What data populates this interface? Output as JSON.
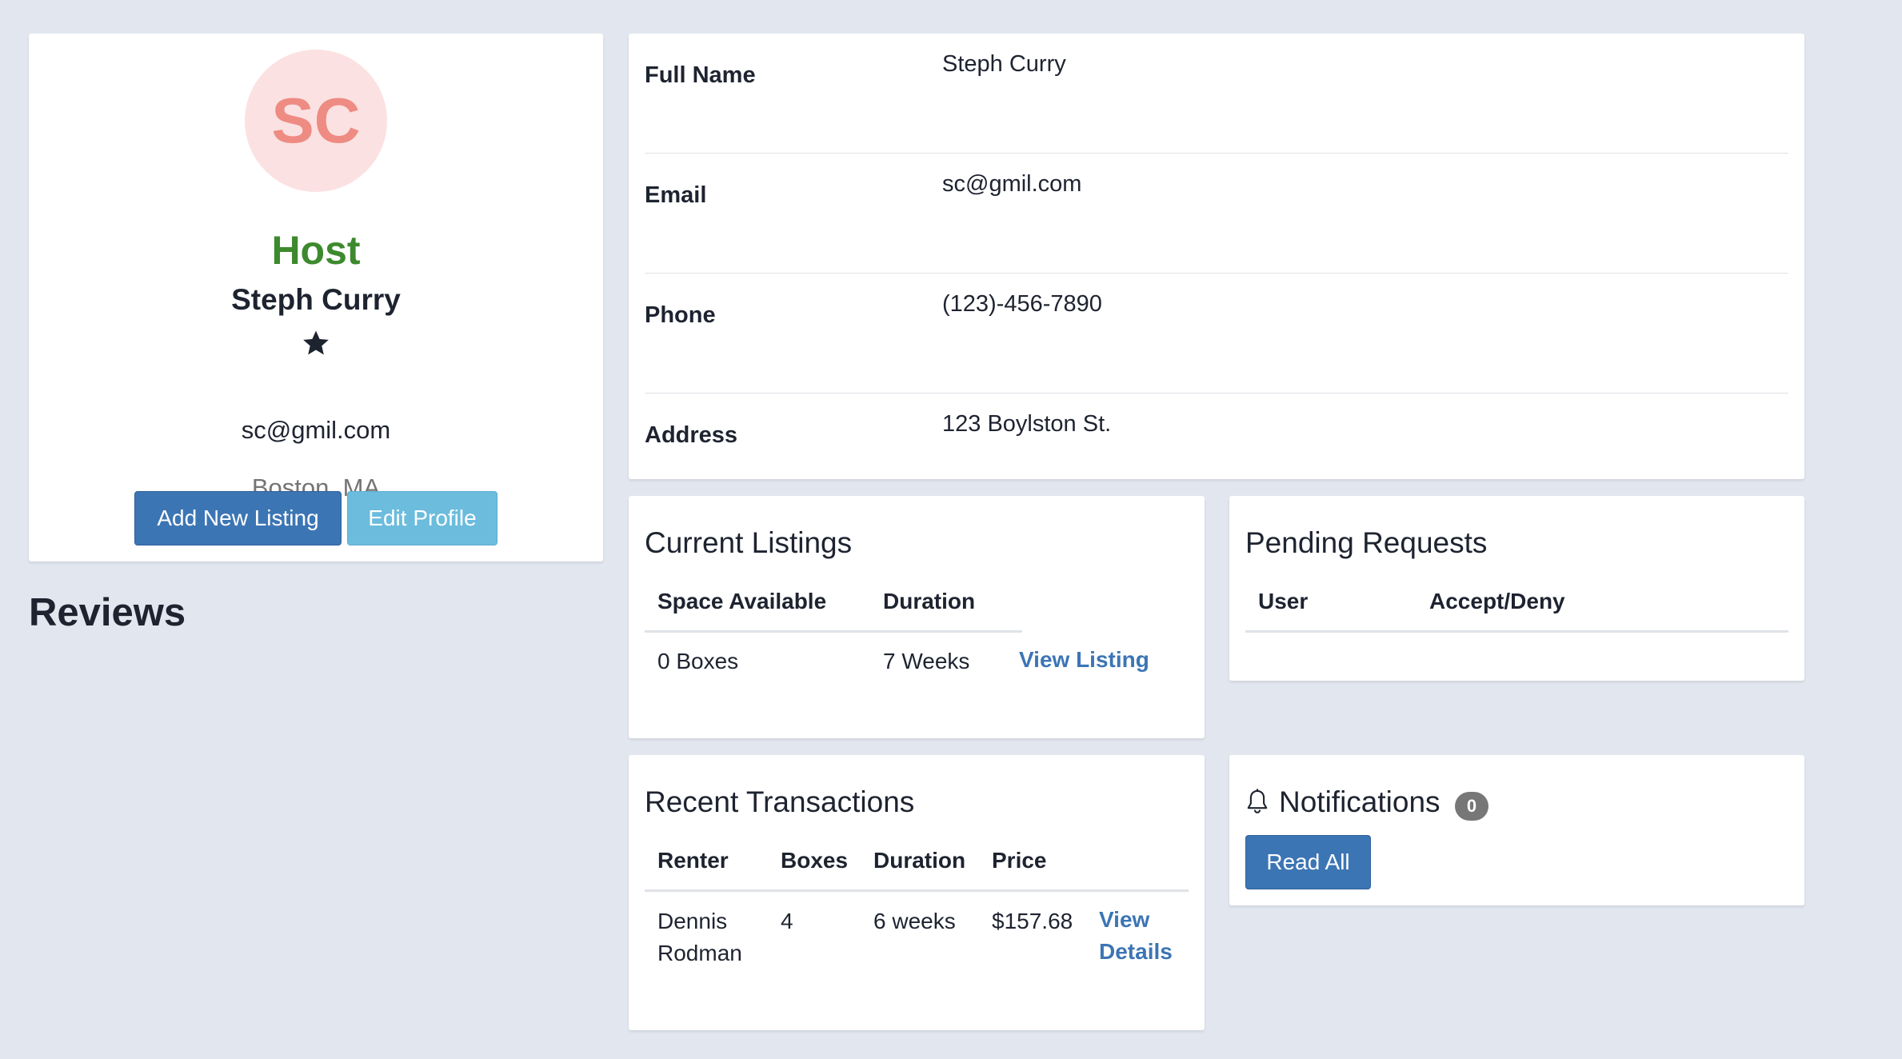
{
  "profile": {
    "initials": "SC",
    "role": "Host",
    "name": "Steph Curry",
    "rating_stars": 1,
    "email": "sc@gmil.com",
    "location": "Boston, MA",
    "add_listing_label": "Add New Listing",
    "edit_profile_label": "Edit Profile"
  },
  "reviews": {
    "title": "Reviews"
  },
  "details": {
    "rows": [
      {
        "label": "Full Name",
        "value": "Steph Curry"
      },
      {
        "label": "Email",
        "value": "sc@gmil.com"
      },
      {
        "label": "Phone",
        "value": "(123)-456-7890"
      },
      {
        "label": "Address",
        "value": "123 Boylston St."
      }
    ]
  },
  "listings": {
    "title": "Current Listings",
    "headers": [
      "Space Available",
      "Duration"
    ],
    "rows": [
      {
        "space": "0 Boxes",
        "duration": "7 Weeks",
        "link": "View Listing"
      }
    ]
  },
  "pending": {
    "title": "Pending Requests",
    "headers": [
      "User",
      "Accept/Deny"
    ]
  },
  "transactions": {
    "title": "Recent Transactions",
    "headers": [
      "Renter",
      "Boxes",
      "Duration",
      "Price"
    ],
    "rows": [
      {
        "renter_first": "Dennis",
        "renter_last": "Rodman",
        "boxes": "4",
        "duration": "6 weeks",
        "price": "$157.68",
        "link_line1": "View",
        "link_line2": "Details"
      }
    ]
  },
  "notifications": {
    "title": "Notifications",
    "count": "0",
    "read_all_label": "Read All"
  },
  "colors": {
    "page_bg": "#e2e6ee",
    "primary": "#3c75b4",
    "info": "#6bbcdd",
    "host_green": "#3d8a2e",
    "avatar_bg": "#fbe1e1",
    "avatar_text": "#ee8b82"
  },
  "icons": [
    "star-icon",
    "bell-icon"
  ]
}
